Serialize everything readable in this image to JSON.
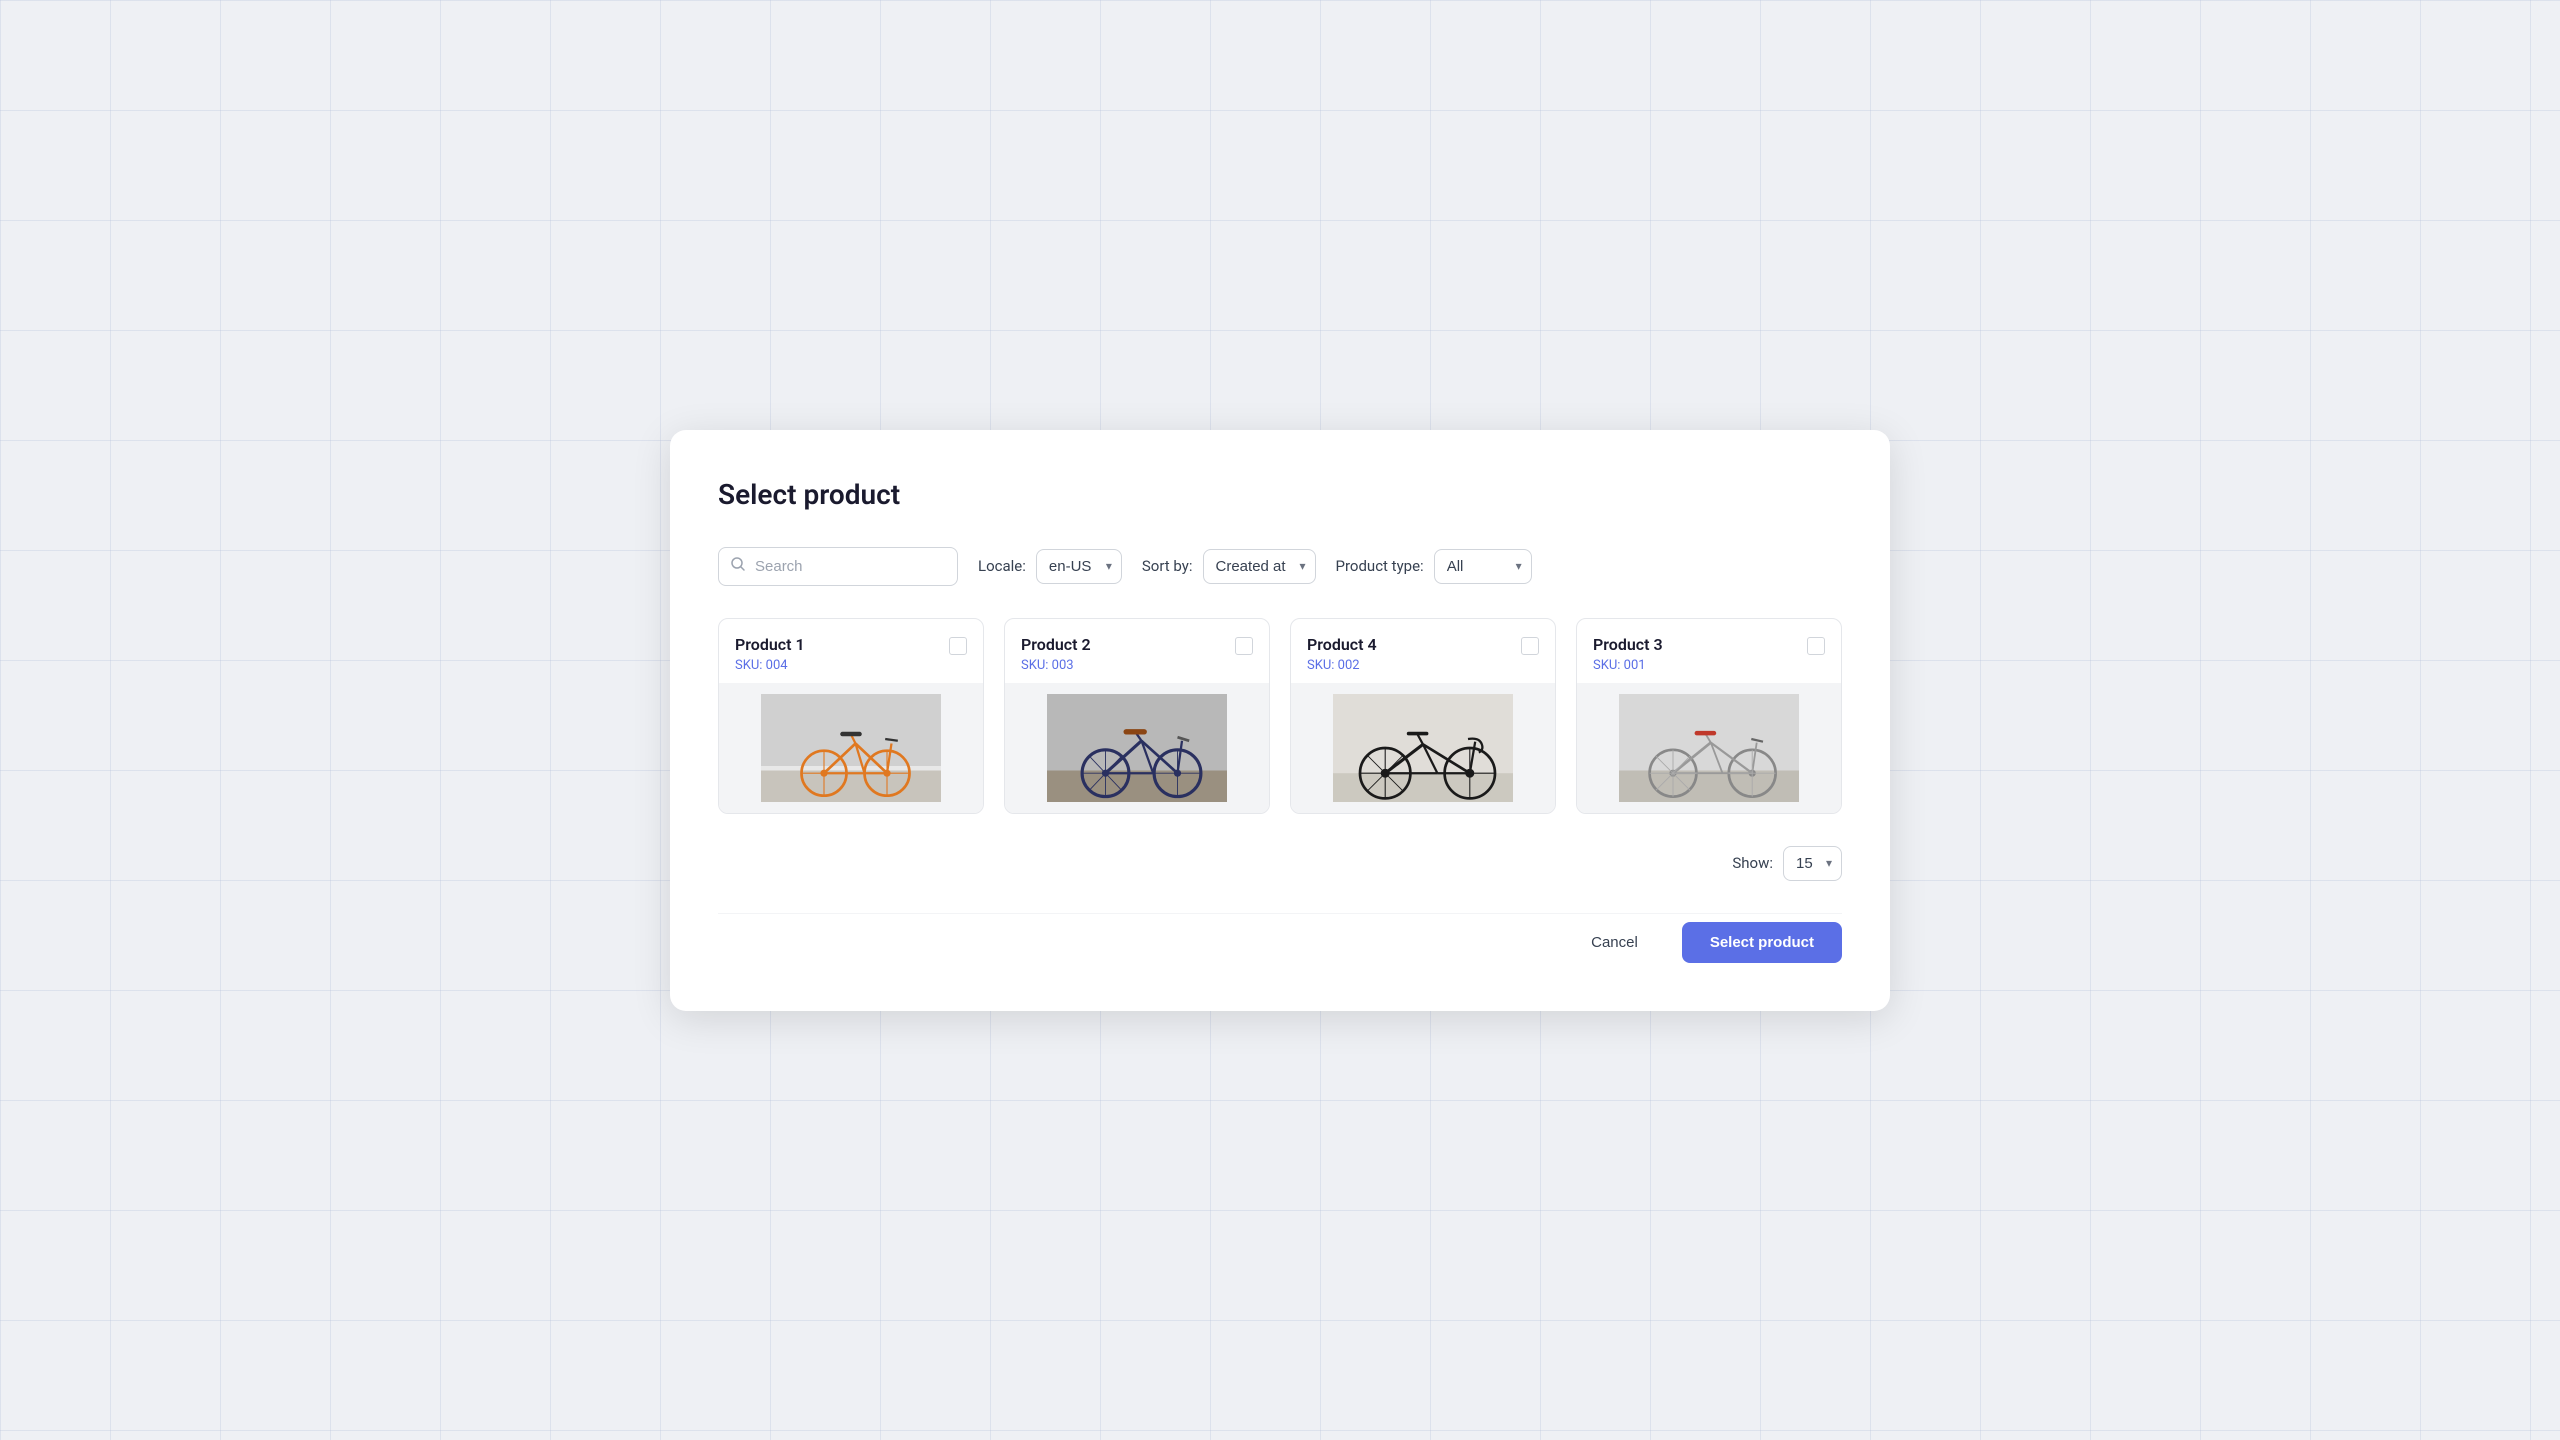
{
  "modal": {
    "title": "Select product",
    "cancel_label": "Cancel",
    "select_label": "Select product"
  },
  "filters": {
    "search_placeholder": "Search",
    "locale_label": "Locale:",
    "locale_value": "en-US",
    "sort_label": "Sort by:",
    "sort_value": "Created at",
    "product_type_label": "Product type:",
    "product_type_value": "All"
  },
  "pagination": {
    "show_label": "Show:",
    "show_value": "15"
  },
  "products": [
    {
      "name": "Product 1",
      "sku": "SKU: 004",
      "bike_color": "orange",
      "id": "product-1"
    },
    {
      "name": "Product 2",
      "sku": "SKU: 003",
      "bike_color": "dark",
      "id": "product-2"
    },
    {
      "name": "Product 4",
      "sku": "SKU: 002",
      "bike_color": "black-road",
      "id": "product-4"
    },
    {
      "name": "Product 3",
      "sku": "SKU: 001",
      "bike_color": "silver",
      "id": "product-3"
    }
  ]
}
